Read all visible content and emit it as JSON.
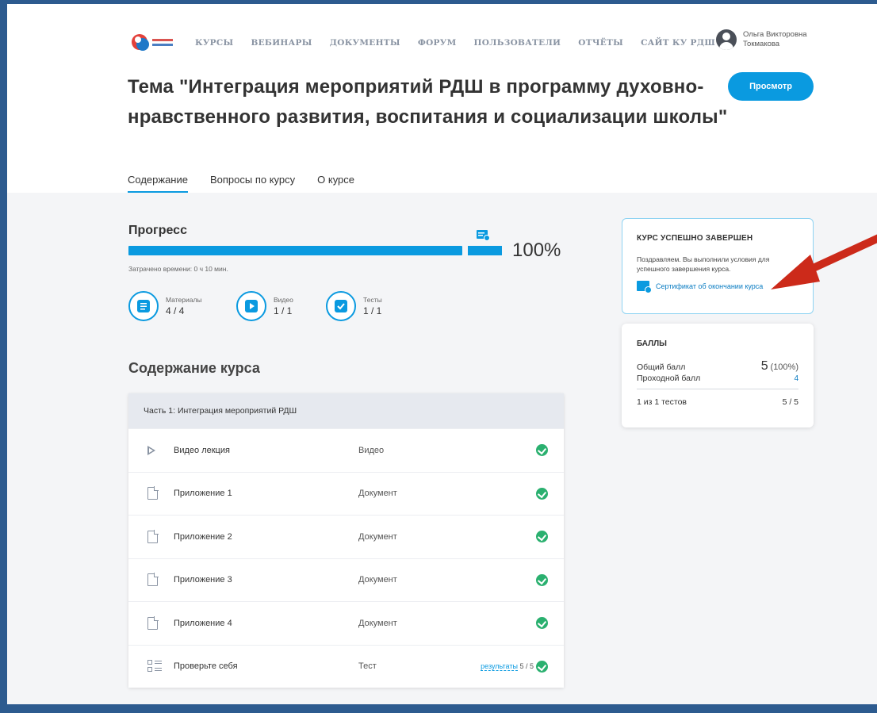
{
  "nav": {
    "links": [
      "КУРСЫ",
      "ВЕБИНАРЫ",
      "ДОКУМЕНТЫ",
      "ФОРУМ",
      "ПОЛЬЗОВАТЕЛИ",
      "ОТЧЁТЫ",
      "САЙТ КУ РДШ"
    ],
    "user_line1": "Ольга Викторовна",
    "user_line2": "Токмакова"
  },
  "page": {
    "title": "Тема \"Интеграция мероприятий РДШ в программу духовно-нравственного развития, воспитания и социализации школы\"",
    "view_button": "Просмотр",
    "tabs": [
      "Содержание",
      "Вопросы по курсу",
      "О курсе"
    ]
  },
  "progress": {
    "title": "Прогресс",
    "percent_label": "100%",
    "percent": 100,
    "time_spent": "Затрачено времени: 0 ч 10 мин.",
    "stats": [
      {
        "label": "Материалы",
        "value": "4 / 4"
      },
      {
        "label": "Видео",
        "value": "1 / 1"
      },
      {
        "label": "Тесты",
        "value": "1 / 1"
      }
    ]
  },
  "content": {
    "title": "Содержание курса",
    "section": "Часть 1: Интеграция мероприятий РДШ",
    "items": [
      {
        "name": "Видео лекция",
        "type": "Видео",
        "icon": "play-icon"
      },
      {
        "name": "Приложение 1",
        "type": "Документ",
        "icon": "document-icon"
      },
      {
        "name": "Приложение 2",
        "type": "Документ",
        "icon": "document-icon"
      },
      {
        "name": "Приложение 3",
        "type": "Документ",
        "icon": "document-icon"
      },
      {
        "name": "Приложение 4",
        "type": "Документ",
        "icon": "document-icon"
      },
      {
        "name": "Проверьте себя",
        "type": "Тест",
        "icon": "test-icon",
        "results_link": "результаты",
        "results_score": "5 / 5"
      }
    ]
  },
  "completion": {
    "title": "КУРС УСПЕШНО ЗАВЕРШЕН",
    "text": "Поздравляем. Вы выполнили условия для успешного завершения курса.",
    "cert_link": "Сертификат об окончании курса"
  },
  "score": {
    "title": "БАЛЛЫ",
    "total_label": "Общий балл",
    "total_value": "5",
    "total_pct": "(100%)",
    "pass_label": "Проходной балл",
    "pass_value": "4",
    "tests_label": "1 из 1 тестов",
    "tests_value": "5 / 5"
  },
  "colors": {
    "accent": "#0a9ae0",
    "success": "#2ab06f",
    "frame": "#2d5b8f",
    "arrow": "#cc2a1a"
  }
}
